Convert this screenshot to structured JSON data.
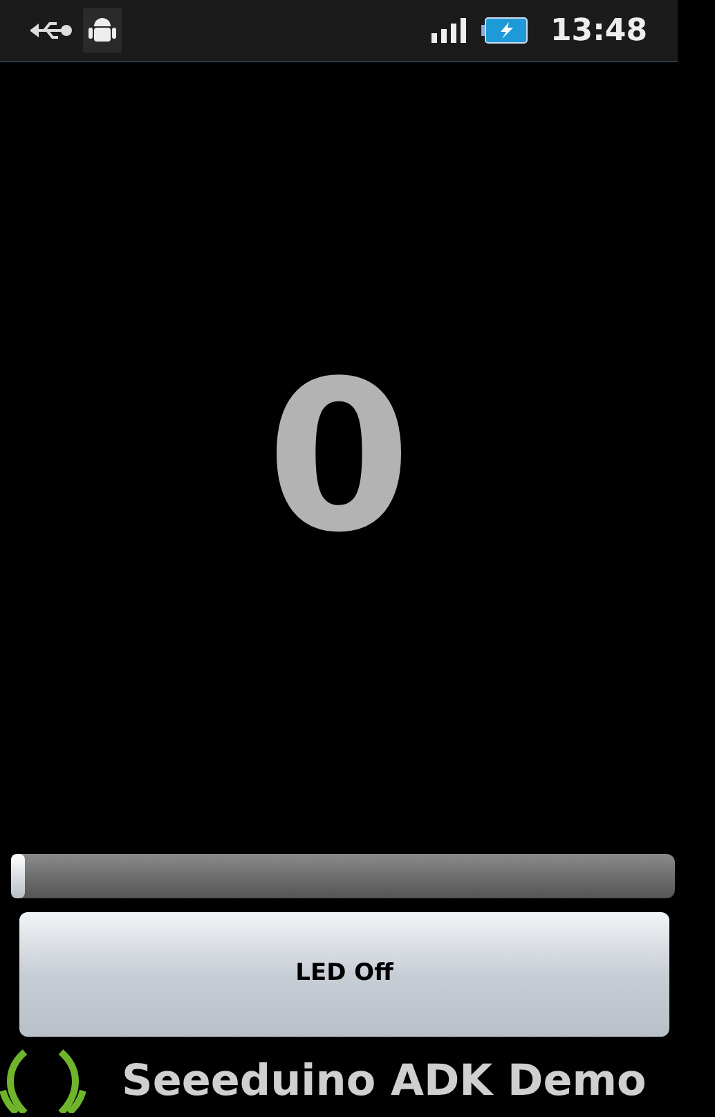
{
  "status_bar": {
    "time": "13:48"
  },
  "counter": {
    "value": "0"
  },
  "slider": {
    "level": 0
  },
  "led_button": {
    "label": "LED Off"
  },
  "footer": {
    "title": "Seeeduino ADK Demo"
  }
}
